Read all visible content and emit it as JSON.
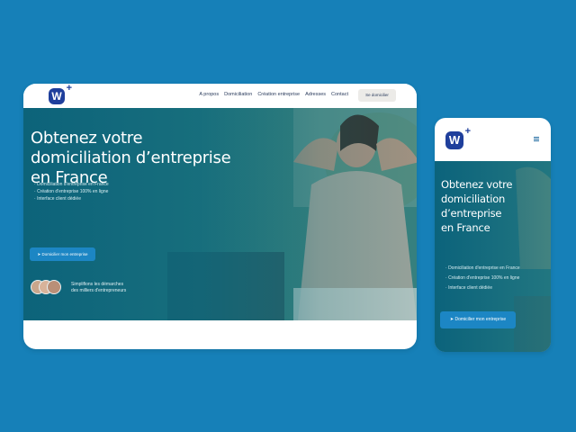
{
  "desktop": {
    "nav": {
      "links": [
        "A propos",
        "Domiciliation",
        "Création entreprise",
        "Adresses",
        "Contact"
      ],
      "button": "Se domicilier"
    },
    "hero": {
      "title_lines": [
        "Obtenez votre",
        "domiciliation d’entreprise",
        "en France"
      ],
      "features": [
        "Domiciliation d'entreprise en France",
        "Création d'entreprise 100% en ligne",
        "Interface client dédiée"
      ],
      "cta": "Domicilier mon entreprise",
      "social_proof": [
        "Simplifions les démarches",
        "des milliers d'entrepreneurs"
      ]
    }
  },
  "mobile": {
    "hero": {
      "title_lines": [
        "Obtenez votre",
        "domiciliation",
        "d’entreprise",
        "en France"
      ],
      "features": [
        "Domiciliation d'entreprise en France",
        "Création d'entreprise 100% en ligne",
        "Interface client dédiée"
      ],
      "cta": "Domicilier mon entreprise"
    }
  },
  "logo": {
    "letter": "W",
    "mark": "+"
  },
  "icons": {
    "cta": "paper-plane-icon",
    "menu": "hamburger-icon"
  },
  "colors": {
    "background": "#1680b8",
    "brand": "#1f3f9c",
    "cta": "#1c86c4",
    "hero_overlay": "#0c6e8c"
  }
}
